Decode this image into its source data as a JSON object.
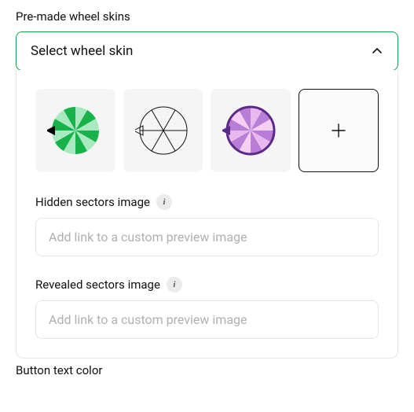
{
  "section_label": "Pre-made wheel skins",
  "select": {
    "label": "Select wheel skin"
  },
  "skins": [
    {
      "name": "green-wheel"
    },
    {
      "name": "outline-wheel"
    },
    {
      "name": "purple-wheel"
    },
    {
      "name": "add-new"
    }
  ],
  "hidden_sectors": {
    "label": "Hidden sectors image",
    "info": "i",
    "placeholder": "Add link to a custom preview image"
  },
  "revealed_sectors": {
    "label": "Revealed sectors image",
    "info": "i",
    "placeholder": "Add link to a custom preview image"
  },
  "bottom_label": "Button text color"
}
